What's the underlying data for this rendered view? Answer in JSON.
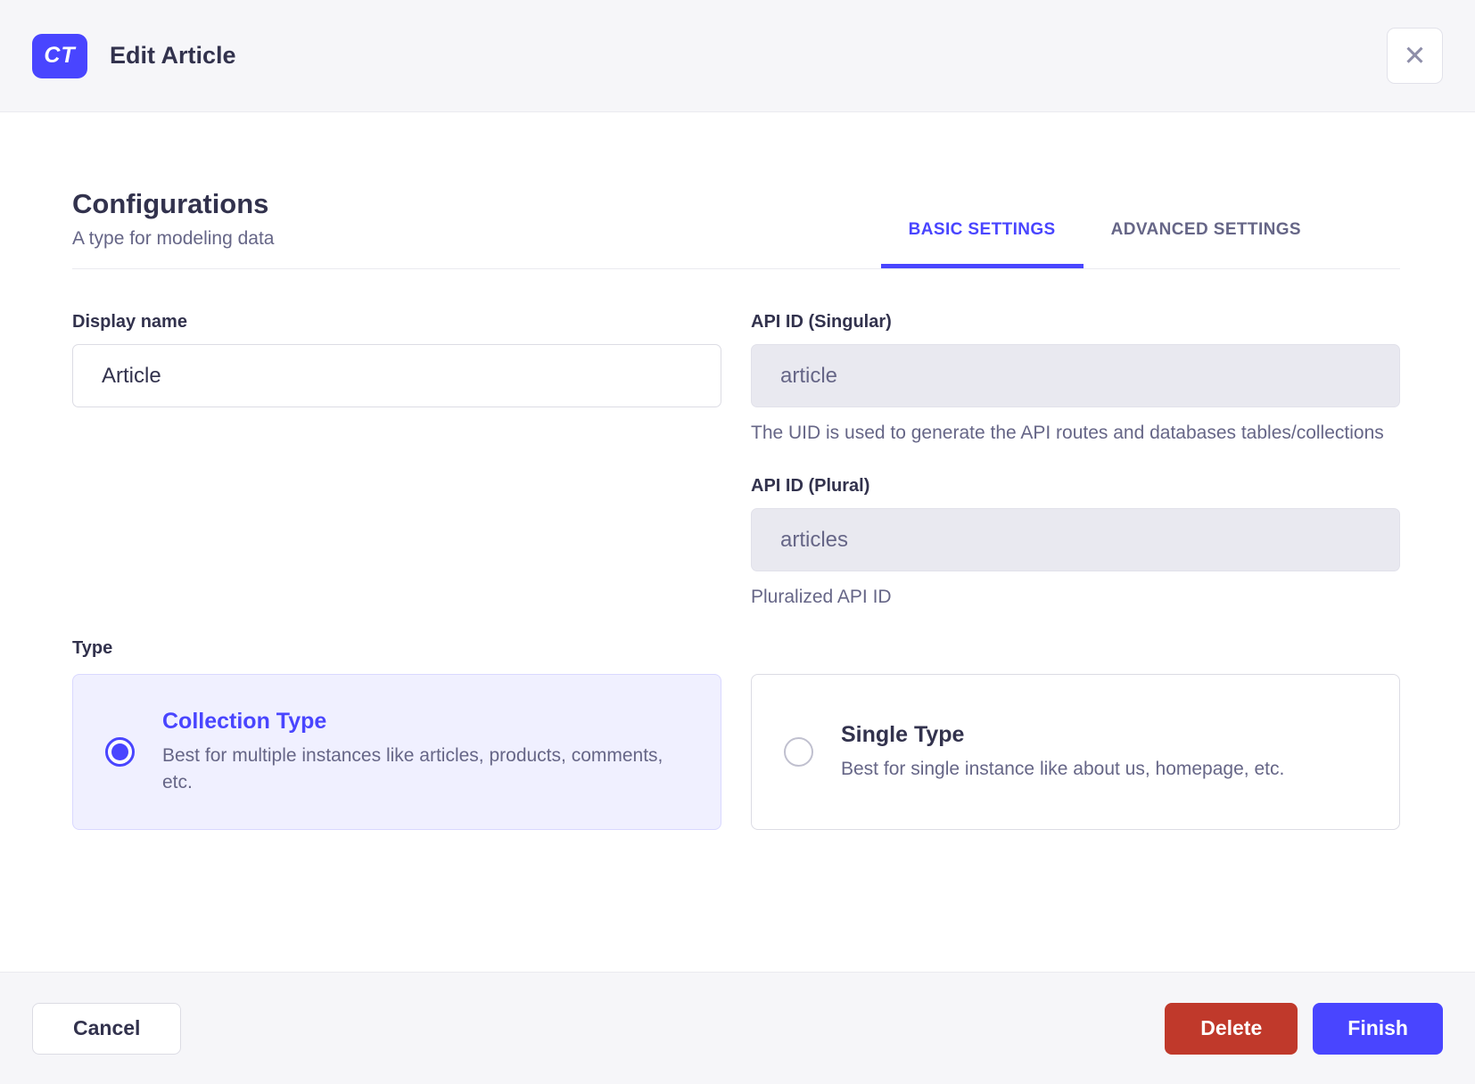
{
  "colors": {
    "primary": "#4945ff",
    "danger": "#c0392b",
    "selected_card_background": "#f0f0ff",
    "header_footer_background": "#f6f6f9",
    "text_dark": "#32324d",
    "text_grey": "#666687"
  },
  "modal": {
    "header": {
      "badge": "CT",
      "title": "Edit Article",
      "close_icon": "✕"
    },
    "section": {
      "title": "Configurations",
      "subtitle": "A type for modeling data",
      "tabs": [
        {
          "label": "BASIC SETTINGS",
          "active": true
        },
        {
          "label": "ADVANCED SETTINGS",
          "active": false
        }
      ]
    },
    "form": {
      "display_name": {
        "label": "Display name",
        "value": "Article"
      },
      "api_id_singular": {
        "label": "API ID (Singular)",
        "value": "article",
        "hint": "The UID is used to generate the API routes and databases tables/collections"
      },
      "api_id_plural": {
        "label": "API ID (Plural)",
        "value": "articles",
        "hint": "Pluralized API ID"
      },
      "type": {
        "label": "Type",
        "options": [
          {
            "title": "Collection Type",
            "description": "Best for multiple instances like articles, products, comments, etc.",
            "selected": true
          },
          {
            "title": "Single Type",
            "description": "Best for single instance like about us, homepage, etc.",
            "selected": false
          }
        ]
      }
    },
    "footer": {
      "cancel": "Cancel",
      "delete": "Delete",
      "finish": "Finish"
    }
  }
}
